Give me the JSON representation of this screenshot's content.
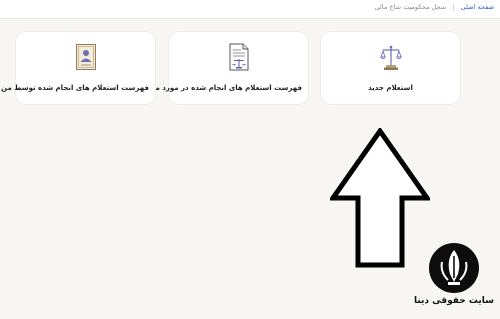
{
  "breadcrumb": {
    "home": "صفحه اصلی",
    "current": "سجل محکومیت شاخ مالی"
  },
  "cards": [
    {
      "label": "استعلام جدید",
      "icon": "scales-icon"
    },
    {
      "label": "فهرست استعلام های انجام شده در مورد من",
      "icon": "document-scales-icon"
    },
    {
      "label": "فهرست استعلام های انجام شده توسط من",
      "icon": "person-certificate-icon"
    }
  ],
  "watermark": {
    "text": "سایت حقوقی دینا"
  },
  "colors": {
    "accent": "#3b63c4",
    "background": "#f8f6f3",
    "card": "#ffffff"
  }
}
